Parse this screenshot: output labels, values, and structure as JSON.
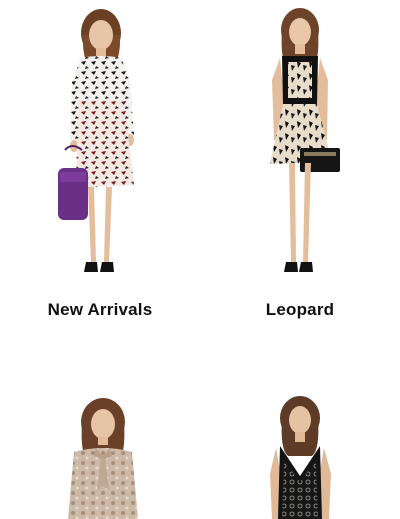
{
  "categories": [
    {
      "label": "New Arrivals",
      "image_icon": "model-print-wrap-dress-purple-bag"
    },
    {
      "label": "Leopard",
      "image_icon": "model-leopard-dress-clutch"
    },
    {
      "label": "",
      "image_icon": "model-blouse-bow"
    },
    {
      "label": "",
      "image_icon": "model-black-lace-gown"
    }
  ],
  "colors": {
    "background": "#ffffff",
    "label": "#111111",
    "purple_bag": "#6a2f86"
  }
}
